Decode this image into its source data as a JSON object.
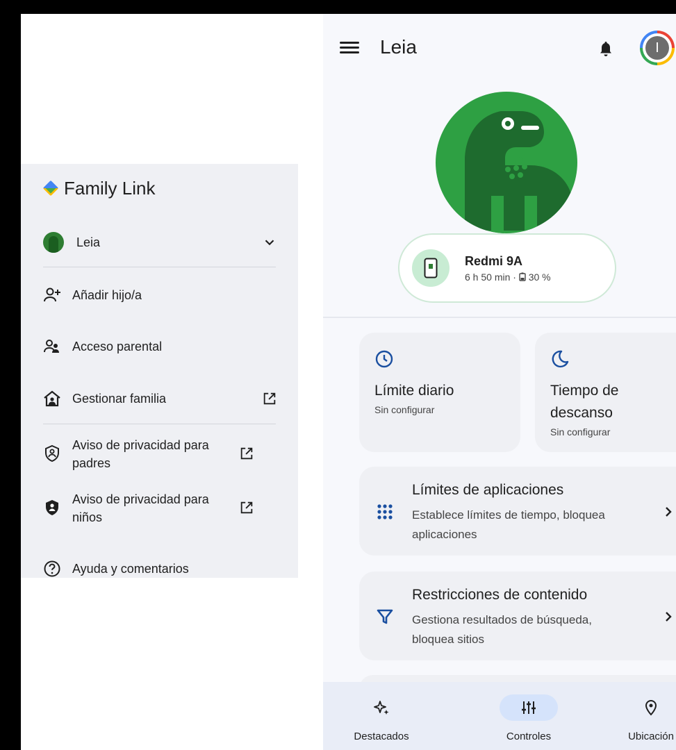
{
  "drawer": {
    "app_name": "Family Link",
    "child_name": "Leia",
    "items": [
      {
        "label": "Añadir hijo/a"
      },
      {
        "label": "Acceso parental"
      },
      {
        "label": "Gestionar familia"
      },
      {
        "label": "Aviso de privacidad para padres"
      },
      {
        "label": "Aviso de privacidad para niños"
      },
      {
        "label": "Ayuda y comentarios"
      }
    ]
  },
  "header": {
    "title": "Leia",
    "avatar_initial": "I"
  },
  "device": {
    "name": "Redmi 9A",
    "usage": "6 h 50 min",
    "battery": "30 %"
  },
  "cards": {
    "daily_limit": {
      "title": "Límite diario",
      "status": "Sin configurar"
    },
    "downtime": {
      "title": "Tiempo de descanso",
      "status": "Sin configurar"
    },
    "app_limits": {
      "title": "Límites de aplicaciones",
      "description": "Establece límites de tiempo, bloquea aplicaciones"
    },
    "content_restrictions": {
      "title": "Restricciones de contenido",
      "description": "Gestiona resultados de búsqueda, bloquea sitios"
    }
  },
  "bottom_nav": {
    "items": [
      {
        "label": "Destacados"
      },
      {
        "label": "Controles"
      },
      {
        "label": "Ubicación"
      }
    ],
    "active": "Controles"
  },
  "colors": {
    "accent_green": "#2ea043",
    "nav_active": "#d5e3fb",
    "card_bg": "#eff0f4",
    "icon_blue": "#1a4fa0"
  }
}
